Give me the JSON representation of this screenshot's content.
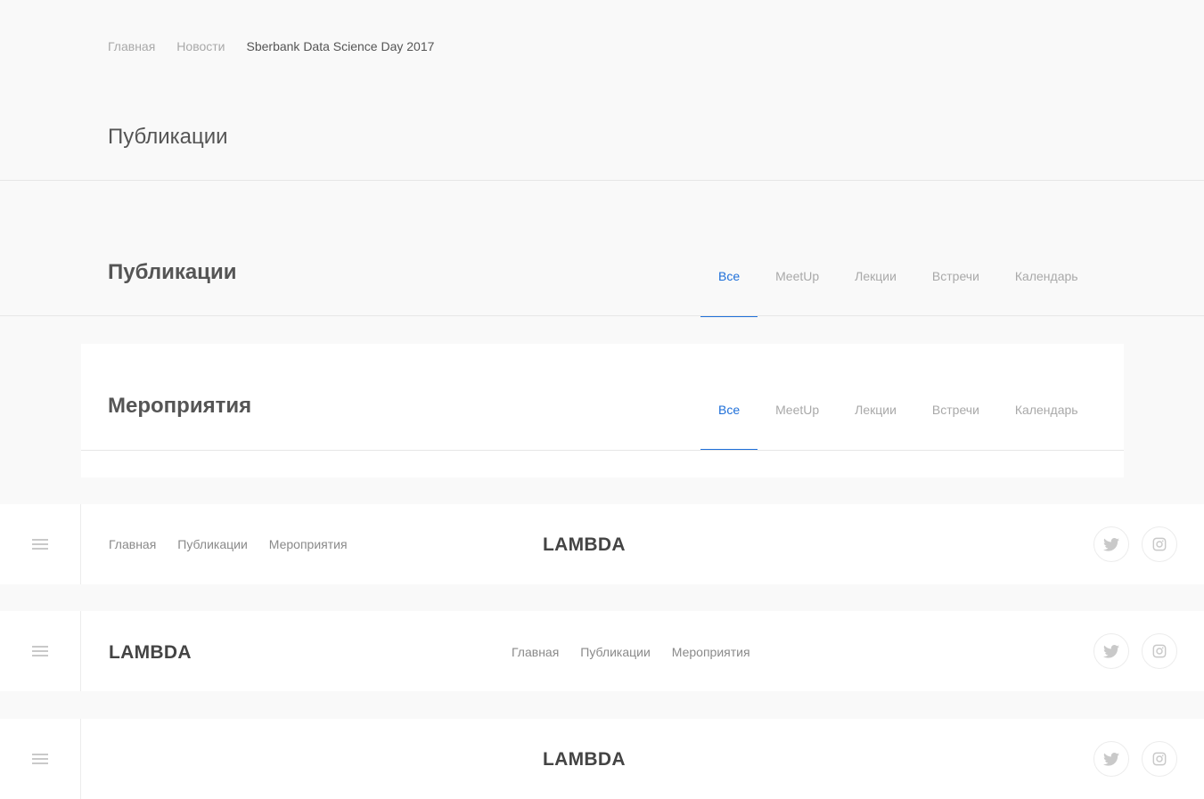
{
  "breadcrumb": {
    "items": [
      "Главная",
      "Новости"
    ],
    "current": "Sberbank Data Science Day 2017"
  },
  "section1": {
    "title": "Публикации"
  },
  "section2": {
    "title": "Публикации",
    "tabs": [
      "Все",
      "MeetUp",
      "Лекции",
      "Встречи",
      "Календарь"
    ],
    "active_tab": "Все"
  },
  "section3": {
    "title": "Мероприятия",
    "tabs": [
      "Все",
      "MeetUp",
      "Лекции",
      "Встречи",
      "Календарь"
    ],
    "active_tab": "Все"
  },
  "header1": {
    "nav": [
      "Главная",
      "Публикации",
      "Мероприятия"
    ],
    "logo": "LAMBDA"
  },
  "header2": {
    "logo": "LAMBDA",
    "nav": [
      "Главная",
      "Публикации",
      "Мероприятия"
    ]
  },
  "header3": {
    "logo": "LAMBDA"
  },
  "icons": {
    "menu": "hamburger-menu-icon",
    "twitter": "twitter-icon",
    "instagram": "instagram-icon"
  },
  "colors": {
    "accent": "#1e6fd9",
    "background": "#f9f9f9",
    "text": "#555555",
    "muted": "#a9a9a9"
  }
}
